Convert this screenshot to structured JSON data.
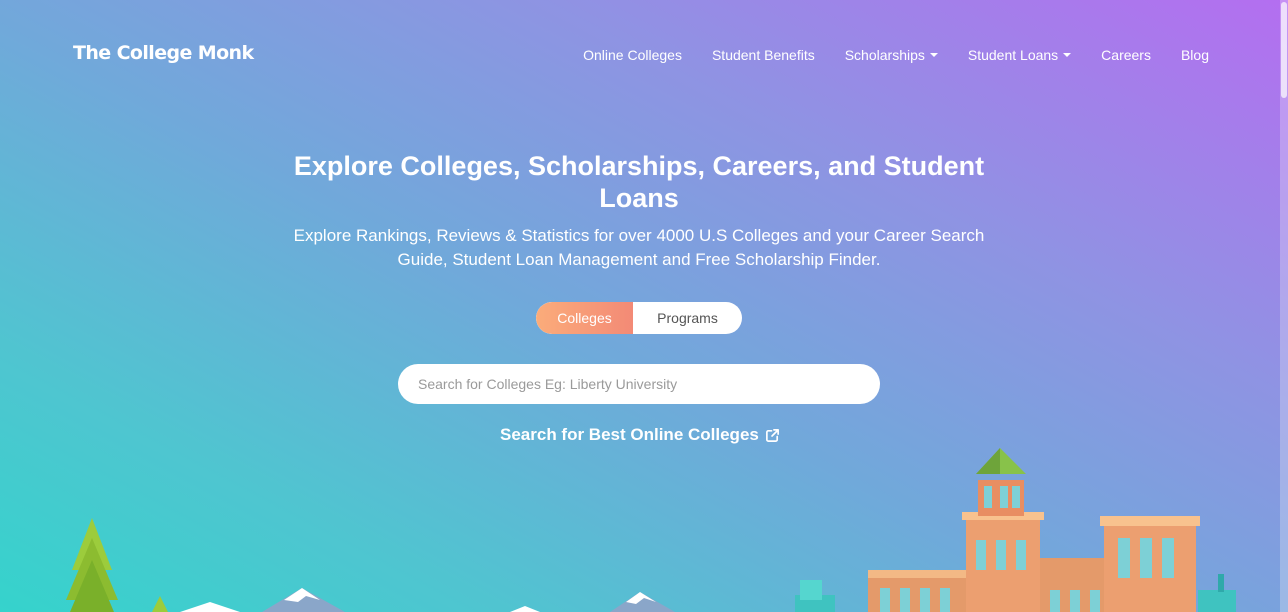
{
  "header": {
    "logo": "The College Monk",
    "nav": [
      {
        "label": "Online Colleges",
        "has_dropdown": false
      },
      {
        "label": "Student Benefits",
        "has_dropdown": false
      },
      {
        "label": "Scholarships",
        "has_dropdown": true
      },
      {
        "label": "Student Loans",
        "has_dropdown": true
      },
      {
        "label": "Careers",
        "has_dropdown": false
      },
      {
        "label": "Blog",
        "has_dropdown": false
      }
    ]
  },
  "hero": {
    "title": "Explore Colleges, Scholarships, Careers, and Student Loans",
    "subtitle": "Explore Rankings, Reviews & Statistics for over 4000 U.S Colleges and your Career Search Guide, Student Loan Management and Free Scholarship Finder."
  },
  "search": {
    "tabs": [
      {
        "label": "Colleges",
        "active": true
      },
      {
        "label": "Programs",
        "active": false
      }
    ],
    "placeholder": "Search for Colleges Eg: Liberty University",
    "value": ""
  },
  "online_link": {
    "label": "Search for Best Online Colleges",
    "icon": "external-link-icon"
  },
  "colors": {
    "gradient_top_right": "#b46ef0",
    "gradient_bottom_left": "#35d3cc",
    "active_tab": "#f7996f",
    "search_bg": "#ffffff"
  }
}
